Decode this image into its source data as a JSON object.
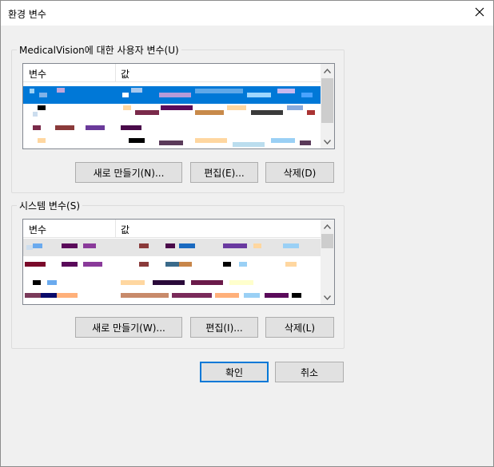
{
  "window": {
    "title": "환경 변수"
  },
  "user_vars": {
    "group_label": "MedicalVision에 대한 사용자 변수(U)",
    "col_name": "변수",
    "col_value": "값",
    "new_button": "새로 만들기(N)...",
    "edit_button": "편집(E)...",
    "delete_button": "삭제(D)"
  },
  "system_vars": {
    "group_label": "시스템 변수(S)",
    "col_name": "변수",
    "col_value": "값",
    "new_button": "새로 만들기(W)...",
    "edit_button": "편집(I)...",
    "delete_button": "삭제(L)"
  },
  "footer": {
    "ok_button": "확인",
    "cancel_button": "취소"
  },
  "colors": {
    "selection": "#0078d7",
    "titlebar_bg": "#ffffff",
    "dialog_bg": "#f0f0f0"
  },
  "icons": [
    "close-icon",
    "scroll-up-arrow-icon",
    "scroll-down-arrow-icon"
  ]
}
